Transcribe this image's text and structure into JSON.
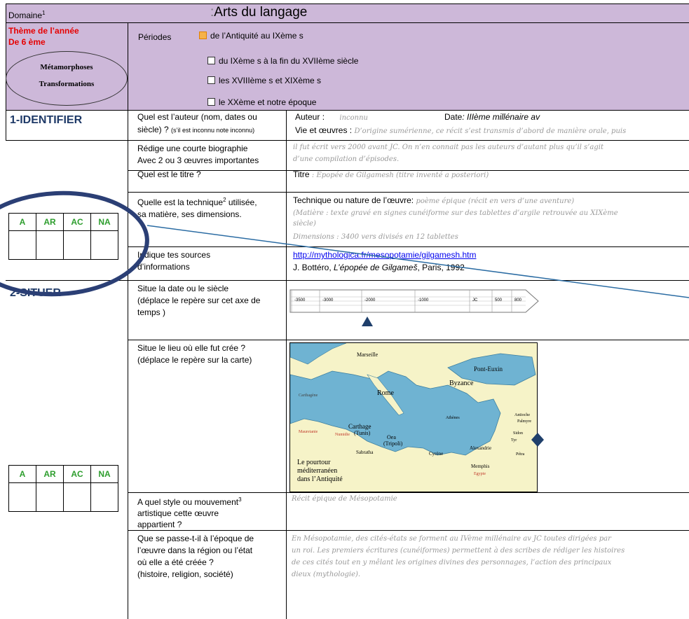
{
  "header": {
    "domain_label": "Domaine",
    "domain_sup": "1",
    "title": "Arts du langage",
    "theme_line1": "Thème  de l’année",
    "theme_line2": "De 6 ème",
    "oval_line1": "Métamorphoses",
    "oval_line2": "Transformations",
    "periods_label": "Périodes",
    "periods": [
      "de l’Antiquité au IXème s",
      "du IXème s à la fin du XVIIème siècle",
      "les XVIIIème s et XIXème s",
      "le XXème et notre époque"
    ]
  },
  "sections": {
    "identifier": "1-IDENTIFIER",
    "situer": "2-SITUER"
  },
  "grades": [
    "A",
    "AR",
    "AC",
    "NA"
  ],
  "questions": {
    "auteur_q1": "Quel est l’auteur (nom, dates ou",
    "auteur_q2": "siècle) ?",
    "auteur_note": "(s’il est inconnu note inconnu)",
    "biographie_q1": "Rédige une courte biographie",
    "biographie_q2": "Avec 2 ou 3 œuvres importantes",
    "titre_q": "Quel est le titre ?",
    "technique_q1": "Quelle est la technique",
    "technique_sup": "2",
    "technique_q1b": " utilisée,",
    "technique_q2": "sa matière, ses dimensions.",
    "sources_q1": "Indique tes sources",
    "sources_q2": "d’informations",
    "date_q1": "Situe la date ou le siècle",
    "date_q2": " (déplace le repère sur cet axe de",
    "date_q3": "temps   )",
    "lieu_q1": "Situe le lieu où elle fut crée ?",
    "lieu_q2": "(déplace le repère  sur la carte)",
    "style_q1": "A quel style ou mouvement",
    "style_sup": "3",
    "style_q2": "artistique cette œuvre",
    "style_q3": "appartient ?",
    "epoque_q1": "Que se passe-t-il  à l’époque de",
    "epoque_q2": "l’œuvre  dans la région ou l’état",
    "epoque_q3": "où elle a été créée ?",
    "epoque_q4": "(histoire, religion, société)"
  },
  "answers": {
    "auteur_label": "Auteur :",
    "auteur_value": "inconnu",
    "date_label": "Date",
    "date_value": ": IIIème millénaire  av",
    "vie_label": "Vie et œuvres :",
    "vie_value": "D’origine sumérienne, ce récit s’est transmis d’abord de manière orale, puis",
    "bio_line1": "il fut écrit vers 2000 avant JC. On n’en connait pas les auteurs d’autant plus qu’il s’agit",
    "bio_line2": "d’une compilation d’épisodes.",
    "titre_label": "Titre",
    "titre_value": ": Epopée de Gilgamesh (titre inventé a posteriori)",
    "technique_label": "Technique ou nature de l’œuvre:",
    "technique_value": "poème épique (récit  en vers d’une aventure)",
    "matiere_line1": "(Matière : texte gravé en signes cunéiforme sur des tablettes d’argile retrouvée au XIXème",
    "matiere_line2": "siècle)",
    "dimensions": "Dimensions : 3400 vers divisés en 12 tablettes",
    "source_link": "http://mythologica.fr/mesopotamie/gilgamesh.htm",
    "source_book_pre": "J. Bottéro, ",
    "source_book_title": "L’épopée de Gilgameš",
    "source_book_post": ", Paris, 1992",
    "style_value": "Récit épique de Mésopotamie",
    "epoque_line1": "En Mésopotamie, des cités-états se forment au IVème millénaire av JC toutes  dirigées par",
    "epoque_line2": "un roi. Les premiers écritures (cunéiformes) permettent à des scribes de rédiger les histoires",
    "epoque_line3": "de ces cités tout en y mêlant les origines divines des personnages, l’action des principaux",
    "epoque_line4": "dieux (mythologie)."
  },
  "timeline": {
    "ticks": [
      "-3500",
      "-3000",
      "-2000",
      "-1000",
      "JC",
      "500",
      "800"
    ],
    "marker_year": -2000
  },
  "map": {
    "labels": {
      "marseille": "Marseille",
      "pont_euxin": "Pont-Euxin",
      "byzance": "Byzance",
      "rome": "Rome",
      "carthage": "Carthage",
      "tunis": "(Tunis)",
      "oea": "Oea",
      "tripoli": "(Tripoli)",
      "sabratha": "Sabratha",
      "cyrene": "Cyrène",
      "alexandrie": "Alexandrie",
      "memphis": "Memphis",
      "antioche": "Antioche",
      "palmyre": "Palmyre",
      "sidon": "Sidon",
      "tyr": "Tyr",
      "petra": "Pétra",
      "athenes": "Athènes",
      "carthagene": "Carthagène",
      "egypte": "Egypte",
      "numidie": "Numidie",
      "mauretanie": "Mauretanie"
    },
    "caption_line1": "Le pourtour",
    "caption_line2": "méditerranéen",
    "caption_line3": "dans l’Antiquité"
  }
}
